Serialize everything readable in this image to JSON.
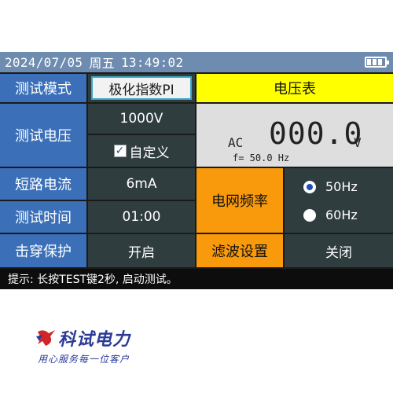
{
  "status_bar": {
    "date": "2024/07/05",
    "weekday": "周五",
    "time": "13:49:02",
    "battery_icon": "battery-full-icon"
  },
  "mode": {
    "label": "测试模式",
    "value": "极化指数PI"
  },
  "voltage": {
    "label": "测试电压",
    "value": "1000V",
    "custom_label": "自定义",
    "custom_checked": true
  },
  "current": {
    "label": "短路电流",
    "value": "6mA"
  },
  "duration": {
    "label": "测试时间",
    "value": "01:00"
  },
  "breakdown": {
    "label": "击穿保护",
    "value": "开启"
  },
  "voltmeter": {
    "title": "电压表",
    "mode": "AC",
    "reading": "000.0",
    "unit": "V",
    "frequency": "f= 50.0 Hz"
  },
  "grid_frequency": {
    "label": "电网频率",
    "options": [
      "50Hz",
      "60Hz"
    ],
    "selected": "50Hz"
  },
  "filter": {
    "label": "滤波设置",
    "value": "关闭"
  },
  "hint": "提示: 长按TEST键2秒, 启动测试。",
  "logo": {
    "brand": "科试电力",
    "slogan": "用心服务每一位客户"
  },
  "colors": {
    "label_blue": "#3b70b8",
    "value_dark": "#2f3d3f",
    "yellow": "#ffff00",
    "orange": "#f89a0c",
    "topbar": "#6e8cb0"
  }
}
